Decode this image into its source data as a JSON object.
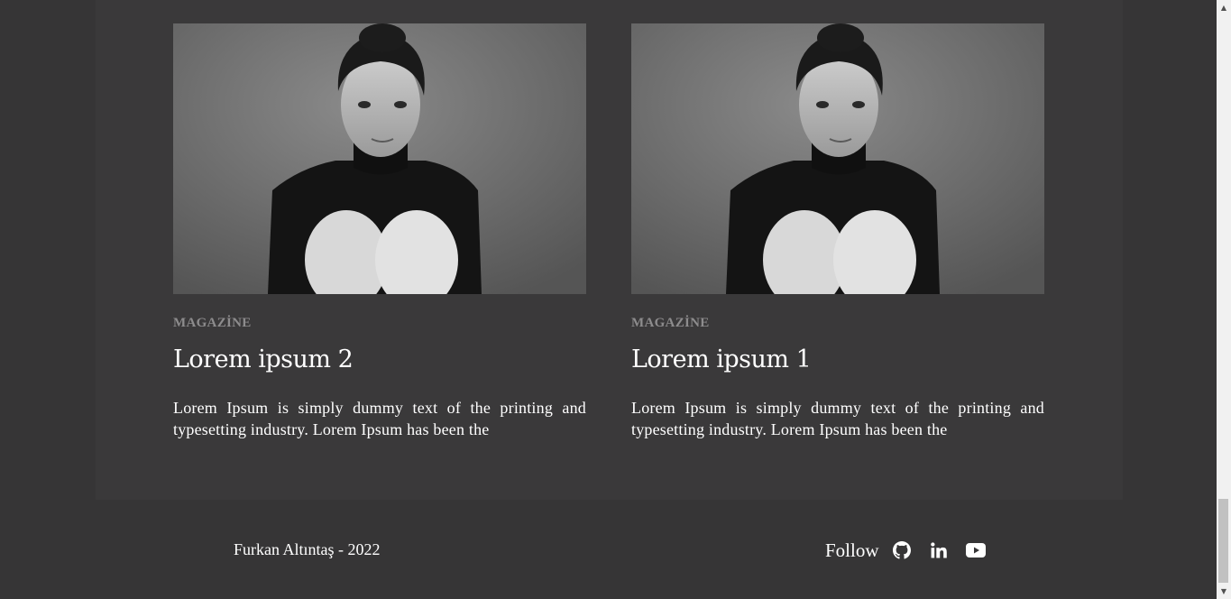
{
  "cards": [
    {
      "category": "MAGAZİNE",
      "title": "Lorem ipsum 2",
      "text": "Lorem Ipsum is simply dummy text of the printing and typesetting industry. Lorem Ipsum has been the"
    },
    {
      "category": "MAGAZİNE",
      "title": "Lorem ipsum 1",
      "text": "Lorem Ipsum is simply dummy text of the printing and typesetting industry. Lorem Ipsum has been the"
    }
  ],
  "footer": {
    "credit": "Furkan Altıntaş - 2022",
    "follow_label": "Follow",
    "social": [
      {
        "icon": "github-icon"
      },
      {
        "icon": "linkedin-icon"
      },
      {
        "icon": "youtube-icon"
      }
    ]
  },
  "scrollbar": {
    "up_arrow": "▲",
    "down_arrow": "▼"
  },
  "colors": {
    "background": "#363536",
    "panel": "#3a393a",
    "category": "#8d8c8d",
    "text": "#ffffff"
  }
}
